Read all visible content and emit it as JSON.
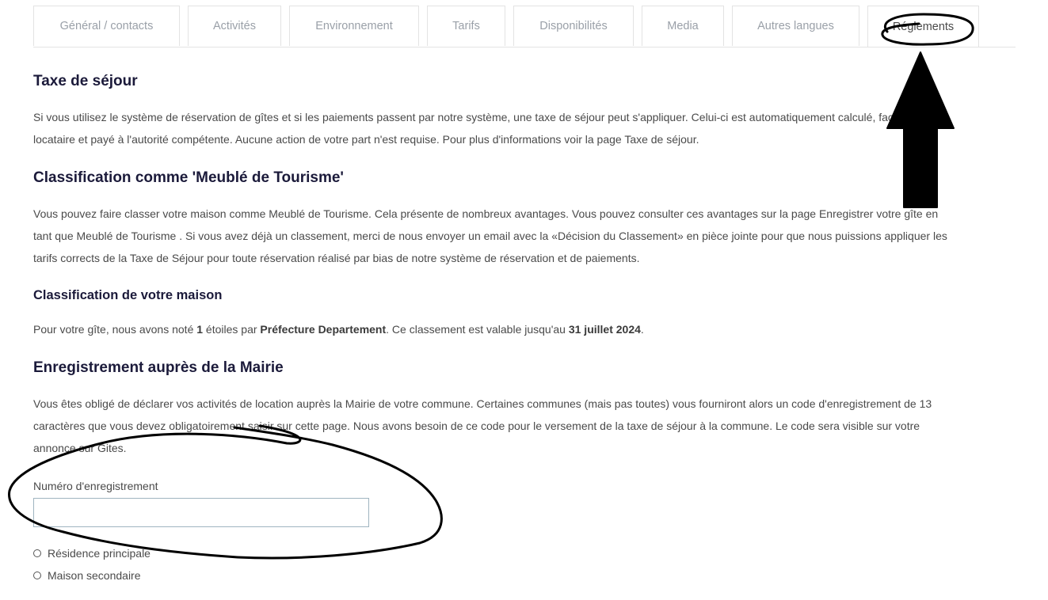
{
  "tabs": [
    {
      "label": "Général / contacts"
    },
    {
      "label": "Activités"
    },
    {
      "label": "Environnement"
    },
    {
      "label": "Tarifs"
    },
    {
      "label": "Disponibilités"
    },
    {
      "label": "Media"
    },
    {
      "label": "Autres langues"
    },
    {
      "label": "Réglements",
      "active": true
    }
  ],
  "sections": {
    "taxe": {
      "title": "Taxe de séjour",
      "text_line1": "Si vous utilisez le système de réservation de gîtes et si les paiements passent par notre système, une taxe de séjour peut s'appliquer. Celui-ci est automatiquement calculé, facturé au",
      "text_line2": "locataire et payé à l'autorité compétente. Aucune action de votre part n'est requise. Pour plus d'informations voir la page Taxe de séjour."
    },
    "classification": {
      "title": "Classification comme 'Meublé de Tourisme'",
      "text_line1": "Vous pouvez faire classer votre maison comme Meublé de Tourisme. Cela présente de nombreux avantages. Vous pouvez consulter ces avantages sur la page Enregistrer votre gîte en",
      "text_line2": "tant que Meublé de Tourisme . Si vous avez déjà un classement, merci de nous envoyer un email avec la «Décision du Classement» en pièce jointe pour que nous puissions appliquer les",
      "text_line3": "tarifs corrects de la Taxe de Séjour pour toute réservation réalisé par bias de notre système de réservation et de paiements."
    },
    "maison": {
      "title": "Classification de votre maison",
      "text_prefix": "Pour votre gîte, nous avons noté ",
      "stars": "1",
      "text_mid1": " étoiles par ",
      "authority": "Préfecture Departement",
      "text_mid2": ". Ce classement est valable jusqu'au ",
      "valid_until": "31 juillet 2024",
      "text_end": "."
    },
    "mairie": {
      "title": "Enregistrement auprès de la Mairie",
      "text_line1": "Vous êtes obligé de déclarer vos activités de location auprès la Mairie de votre commune. Certaines communes (mais pas toutes) vous fourniront alors un code d'enregistrement de 13",
      "text_line2": "caractères que vous devez obligatoirement saisir sur cette page. Nous avons besoin de ce code pour le versement de la taxe de séjour à la commune. Le code sera visible sur votre",
      "text_line3": "annonce sur Gites."
    }
  },
  "form": {
    "registration_label": "Numéro d'enregistrement",
    "registration_value": "",
    "radio_options": [
      {
        "label": "Résidence principale",
        "checked": false
      },
      {
        "label": "Maison secondaire",
        "checked": false
      }
    ]
  },
  "annotations": {
    "ink_color": "#000000"
  }
}
